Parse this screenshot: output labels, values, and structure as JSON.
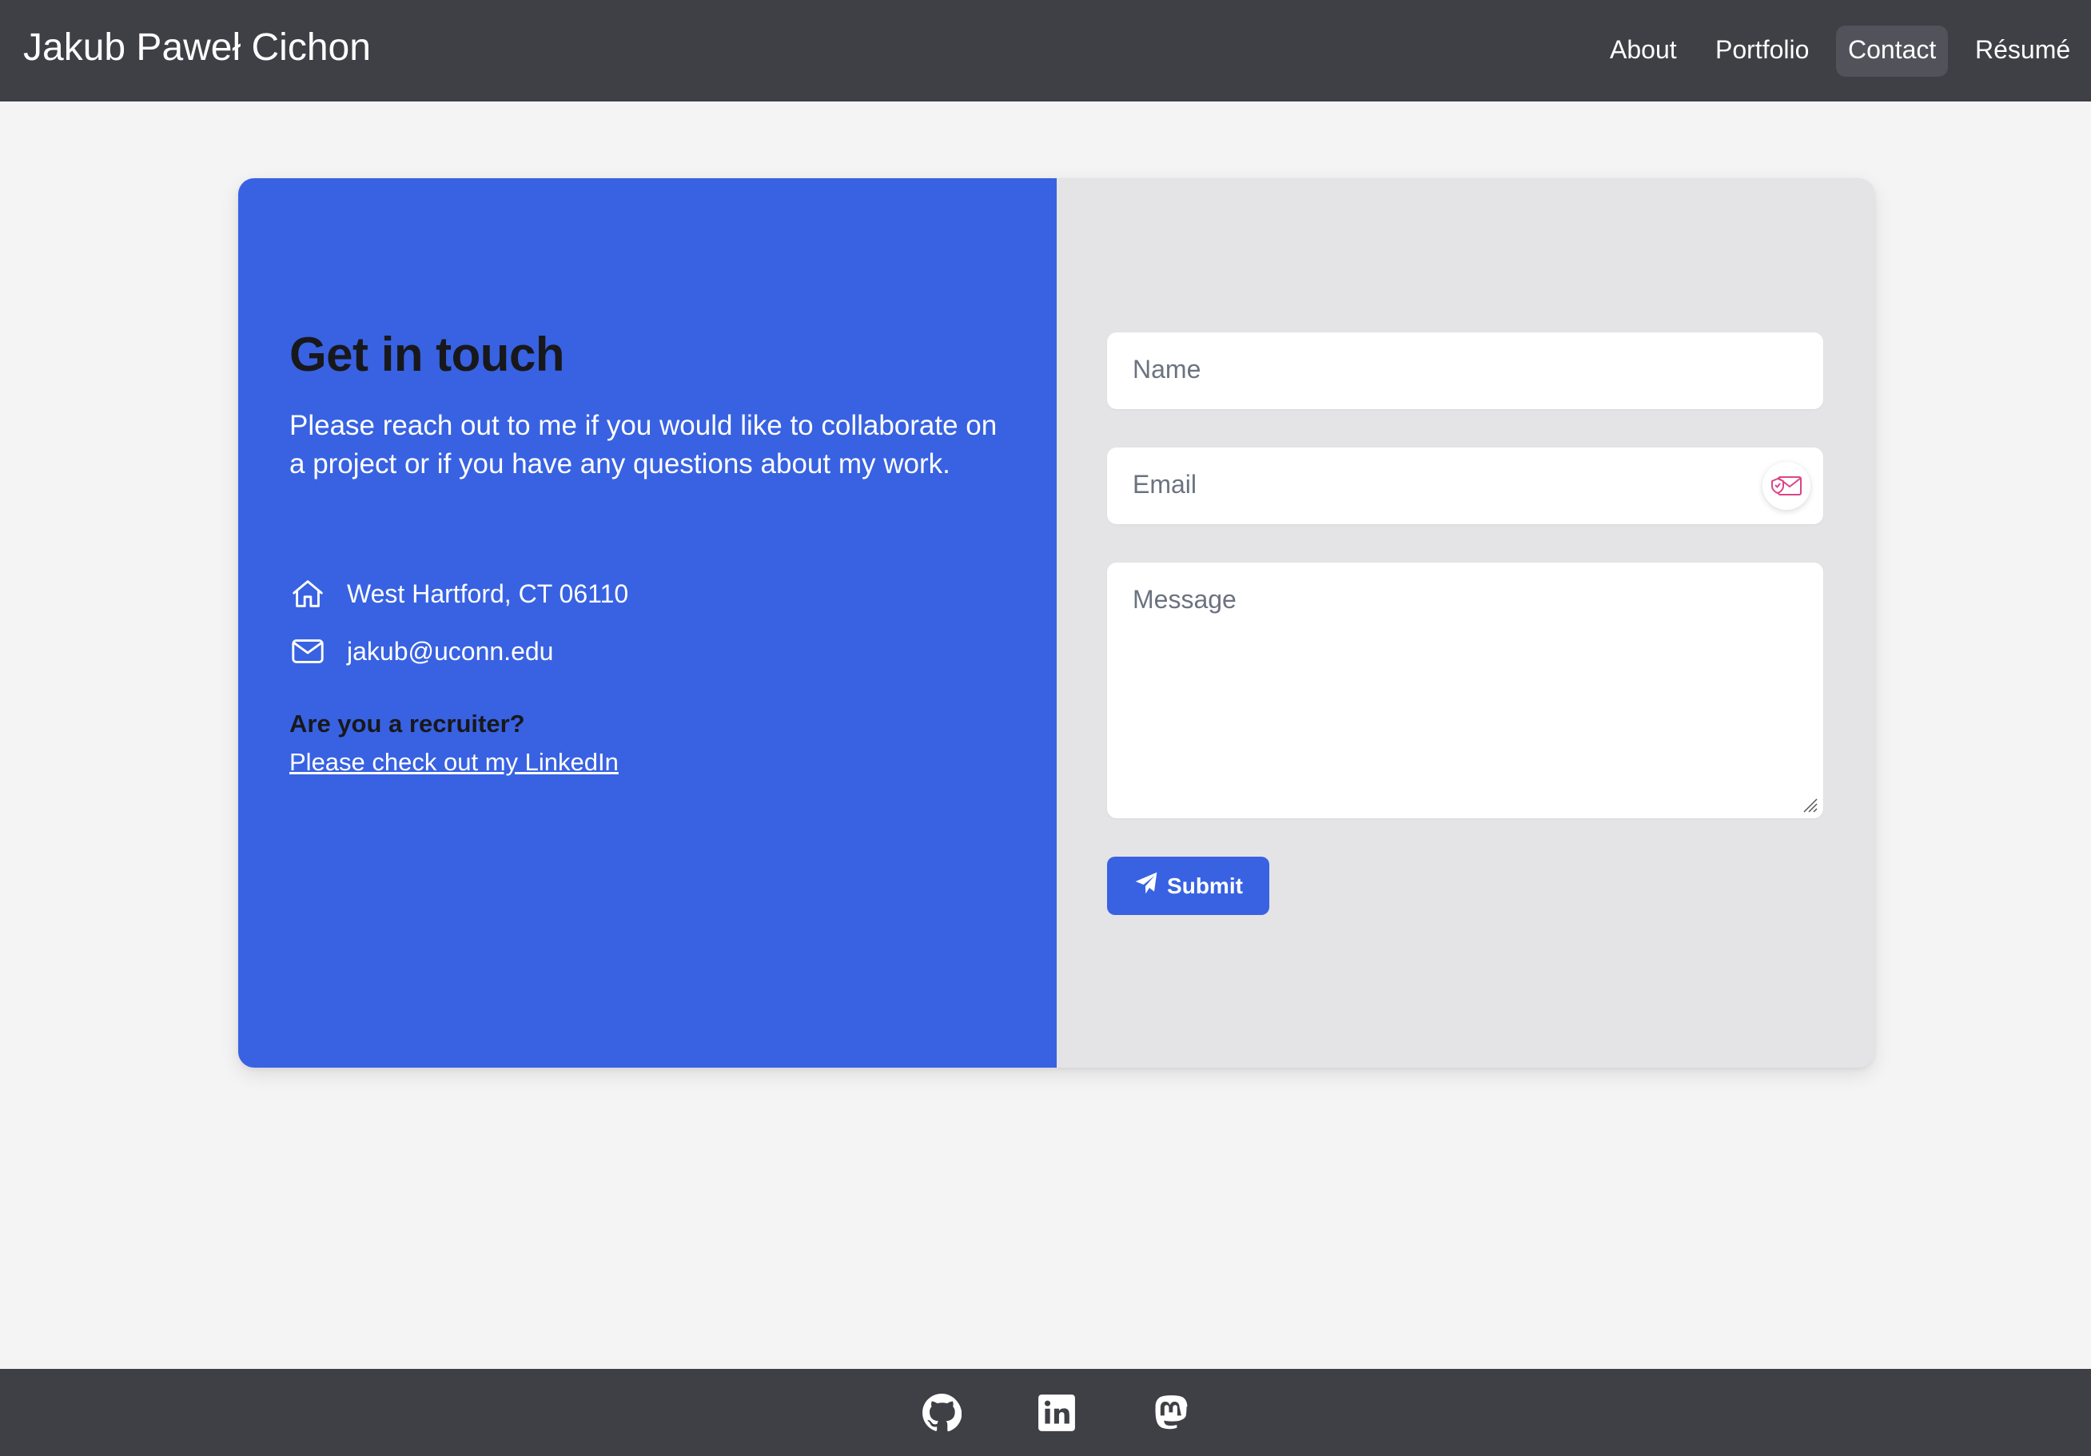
{
  "header": {
    "brand": "Jakub Paweł Cichon",
    "nav": [
      {
        "label": "About",
        "active": false
      },
      {
        "label": "Portfolio",
        "active": false
      },
      {
        "label": "Contact",
        "active": true
      },
      {
        "label": "Résumé",
        "active": false
      }
    ]
  },
  "contact": {
    "heading": "Get in touch",
    "intro": "Please reach out to me if you would like to collaborate on a project or if you have any questions about my work.",
    "address": {
      "icon": "home-icon",
      "text": "West Hartford, CT 06110"
    },
    "email": {
      "icon": "envelope-icon",
      "text": "jakub@uconn.edu"
    },
    "recruiter_question": "Are you a recruiter?",
    "recruiter_link": "Please check out my LinkedIn"
  },
  "form": {
    "name_placeholder": "Name",
    "email_placeholder": "Email",
    "message_placeholder": "Message",
    "submit_label": "Submit",
    "submit_icon": "paper-plane-icon",
    "email_badge_icon": "email-shield-icon"
  },
  "footer": {
    "icons": [
      "github-icon",
      "linkedin-icon",
      "mastodon-icon"
    ]
  },
  "colors": {
    "navbar": "#3f3f46",
    "accent": "#3862e2",
    "page_bg": "#f4f4f5",
    "form_bg": "#e4e4e7"
  }
}
